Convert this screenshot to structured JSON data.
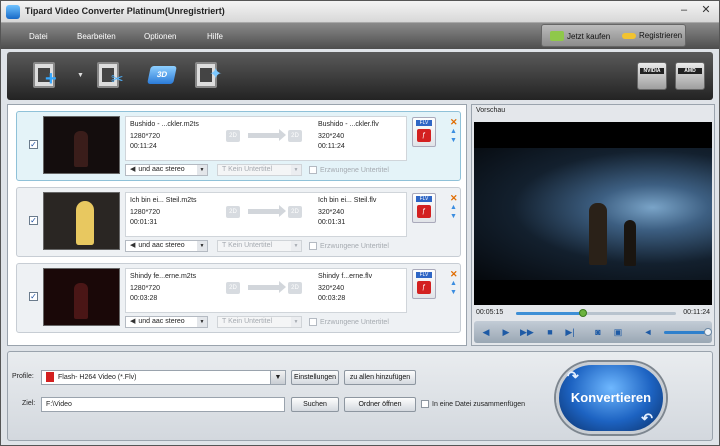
{
  "window": {
    "title": "Tipard Video Converter Platinum(Unregistriert)"
  },
  "menu": {
    "items": [
      "Datei",
      "Bearbeiten",
      "Optionen",
      "Hilfe"
    ]
  },
  "purchase": {
    "buy_label": "Jetzt kaufen",
    "register_label": "Registrieren"
  },
  "toolbar": {
    "tools": [
      "add-video-icon",
      "clip-icon",
      "3d-icon",
      "effect-icon"
    ],
    "gpu_badges": [
      "NVIDIA",
      "AMD"
    ]
  },
  "files": [
    {
      "src_name": "Bushido - ...ckler.m2ts",
      "src_res": "1280*720",
      "src_dur": "00:11:24",
      "dst_name": "Bushido - ...ckler.flv",
      "dst_res": "320*240",
      "dst_dur": "00:11:24",
      "audio": "und aac stereo",
      "subtitle": "Kein Untertitel",
      "forced": "Erzwungene Untertitel",
      "checked": true,
      "format": "FLV"
    },
    {
      "src_name": "Ich bin ei... Steil.m2ts",
      "src_res": "1280*720",
      "src_dur": "00:01:31",
      "dst_name": "Ich bin ei... Steil.flv",
      "dst_res": "320*240",
      "dst_dur": "00:01:31",
      "audio": "und aac stereo",
      "subtitle": "Kein Untertitel",
      "forced": "Erzwungene Untertitel",
      "checked": true,
      "format": "FLV"
    },
    {
      "src_name": "Shindy fe...erne.m2ts",
      "src_res": "1280*720",
      "src_dur": "00:03:28",
      "dst_name": "Shindy f...erne.flv",
      "dst_res": "320*240",
      "dst_dur": "00:03:28",
      "audio": "und aac stereo",
      "subtitle": "Kein Untertitel",
      "forced": "Erzwungene Untertitel",
      "checked": true,
      "format": "FLV"
    }
  ],
  "preview": {
    "label": "Vorschau",
    "time_current": "00:05:15",
    "time_total": "00:11:24",
    "progress_fraction": 0.42
  },
  "bottom": {
    "profile_label": "Profile:",
    "profile_value": "Flash- H264 Video (*.Flv)",
    "settings_label": "Einstellungen",
    "apply_all_label": "zu allen hinzufügen",
    "target_label": "Ziel:",
    "target_value": "F:\\Video",
    "search_label": "Suchen",
    "open_folder_label": "Ordner öffnen",
    "merge_label": "In eine Datei zusammenfügen",
    "convert_label": "Konvertieren"
  }
}
